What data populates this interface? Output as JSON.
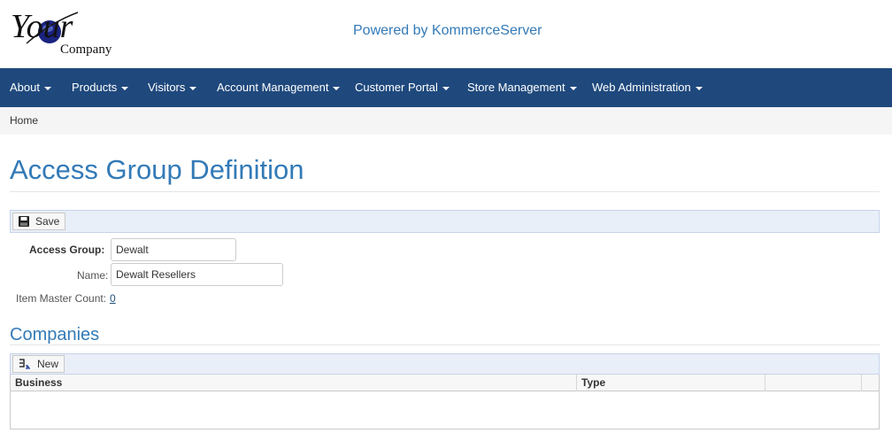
{
  "logo": {
    "brand_main": "Your",
    "brand_sub": "Company"
  },
  "header": {
    "powered_by": "Powered by KommerceServer"
  },
  "nav": {
    "items": [
      {
        "label": "About"
      },
      {
        "label": "Products"
      },
      {
        "label": "Visitors"
      },
      {
        "label": "Account Management"
      },
      {
        "label": "Customer Portal"
      },
      {
        "label": "Store Management"
      },
      {
        "label": "Web Administration"
      }
    ]
  },
  "breadcrumb": {
    "home": "Home"
  },
  "page": {
    "title": "Access Group Definition"
  },
  "toolbar": {
    "save_label": "Save"
  },
  "form": {
    "access_group_label": "Access Group:",
    "access_group_value": "Dewalt",
    "name_label": "Name:",
    "name_value": "Dewalt Resellers",
    "item_master_count_label": "Item Master Count:",
    "item_master_count_value": "0"
  },
  "companies": {
    "title": "Companies",
    "new_label": "New",
    "columns": [
      "Business",
      "Type",
      "",
      ""
    ],
    "rows": []
  },
  "colors": {
    "nav_bg": "#1f497d",
    "accent": "#337ab7",
    "toolbar_bg": "#e9eff8"
  },
  "icons": {
    "save": "floppy-disk-icon",
    "new": "new-record-icon",
    "caret": "caret-down-icon"
  }
}
